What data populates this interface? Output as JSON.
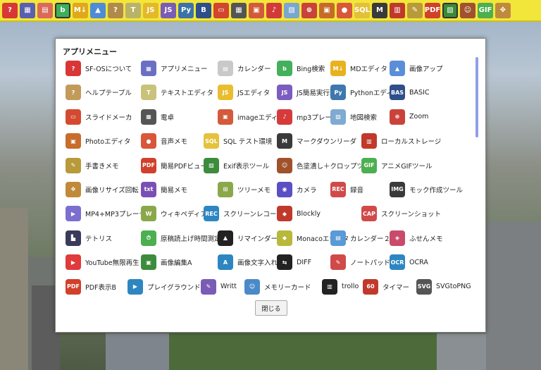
{
  "toolbar": {
    "icons": [
      {
        "name": "help-icon",
        "color": "#d93636",
        "glyph": "?"
      },
      {
        "name": "app-menu-icon",
        "color": "#5a5fb0",
        "glyph": "▦"
      },
      {
        "name": "calendar-icon",
        "color": "#d86a5a",
        "glyph": "▤"
      },
      {
        "name": "bing-icon",
        "color": "#3fae5a",
        "glyph": "b"
      },
      {
        "name": "md-editor-icon",
        "color": "#e0a91c",
        "glyph": "M↓"
      },
      {
        "name": "image-up-icon",
        "color": "#4f8bd6",
        "glyph": "▲"
      },
      {
        "name": "help-table-icon",
        "color": "#b08a4a",
        "glyph": "?"
      },
      {
        "name": "text-editor-icon",
        "color": "#b9b36a",
        "glyph": "T"
      },
      {
        "name": "js-editor-icon",
        "color": "#e5b82a",
        "glyph": "JS"
      },
      {
        "name": "js-runner-icon",
        "color": "#7a5bb5",
        "glyph": "JS"
      },
      {
        "name": "python-icon",
        "color": "#3b73a8",
        "glyph": "Py"
      },
      {
        "name": "basic-icon",
        "color": "#2f4f8a",
        "glyph": "B"
      },
      {
        "name": "slide-icon",
        "color": "#d2452f",
        "glyph": "▭"
      },
      {
        "name": "calculator-icon",
        "color": "#555555",
        "glyph": "▦"
      },
      {
        "name": "image-editor-icon",
        "color": "#d25a3a",
        "glyph": "▣"
      },
      {
        "name": "music-icon",
        "color": "#d23a3a",
        "glyph": "♪"
      },
      {
        "name": "map-icon",
        "color": "#7aa6cf",
        "glyph": "▧"
      },
      {
        "name": "zoom-icon",
        "color": "#c9433a",
        "glyph": "⊕"
      },
      {
        "name": "photo-editor-icon",
        "color": "#c66a2a",
        "glyph": "▣"
      },
      {
        "name": "voice-memo-icon",
        "color": "#d8563a",
        "glyph": "●"
      },
      {
        "name": "sql-icon",
        "color": "#e3c03a",
        "glyph": "SQL"
      },
      {
        "name": "markdown-reader-icon",
        "color": "#3a3a3a",
        "glyph": "M"
      },
      {
        "name": "local-storage-icon",
        "color": "#c0392b",
        "glyph": "▥"
      },
      {
        "name": "handwriting-icon",
        "color": "#b89a3a",
        "glyph": "✎"
      },
      {
        "name": "pdf-icon",
        "color": "#d0402a",
        "glyph": "PDF"
      },
      {
        "name": "exif-icon",
        "color": "#3a8a3a",
        "glyph": "▨"
      },
      {
        "name": "color-crop-icon",
        "color": "#a0522d",
        "glyph": "☺"
      },
      {
        "name": "gif-icon",
        "color": "#4caf50",
        "glyph": "GIF"
      },
      {
        "name": "resize-icon",
        "color": "#c08a3a",
        "glyph": "✥"
      }
    ]
  },
  "menu": {
    "title": "アプリメニュー",
    "close_label": "閉じる",
    "rows": [
      [
        {
          "label": "SF-OSについて",
          "icon": "help-icon",
          "color": "#d93636",
          "glyph": "?"
        },
        {
          "label": "アプリメニュー",
          "icon": "app-menu-icon",
          "color": "#6b6fc4",
          "glyph": "▦"
        },
        {
          "label": "カレンダー",
          "icon": "calendar-icon",
          "color": "#c9c9c9",
          "glyph": "▤"
        },
        {
          "label": "Bing検索",
          "icon": "bing-icon",
          "color": "#43b05c",
          "glyph": "b"
        },
        {
          "label": "MDエディタ",
          "icon": "md-editor-icon",
          "color": "#e8b11e",
          "glyph": "M↓"
        },
        {
          "label": "画像アップ",
          "icon": "image-up-icon",
          "color": "#5a8fd8",
          "glyph": "▲"
        }
      ],
      [
        {
          "label": "ヘルプテーブル",
          "icon": "help-table-icon",
          "color": "#c29a5a",
          "glyph": "?"
        },
        {
          "label": "テキストエディタ",
          "icon": "text-editor-icon",
          "color": "#c9c27a",
          "glyph": "T"
        },
        {
          "label": "JSエディタ",
          "icon": "js-editor-icon",
          "color": "#e9bd2e",
          "glyph": "JS"
        },
        {
          "label": "JS簡易実行環境",
          "icon": "js-runner-icon",
          "color": "#7c5cc0",
          "glyph": "JS"
        },
        {
          "label": "Pythonエディタ",
          "icon": "python-icon",
          "color": "#3e78ae",
          "glyph": "Py"
        },
        {
          "label": "BASIC",
          "icon": "basic-icon",
          "color": "#2f4f8a",
          "glyph": "BAS"
        }
      ],
      [
        {
          "label": "スライドメーカ",
          "icon": "slide-icon",
          "color": "#d44a30",
          "glyph": "▭"
        },
        {
          "label": "電卓",
          "icon": "calculator-icon",
          "color": "#555555",
          "glyph": "▦"
        },
        {
          "label": "imageエディタ",
          "icon": "image-editor-icon",
          "color": "#d35b3b",
          "glyph": "▣"
        },
        {
          "label": "mp3プレーヤ",
          "icon": "music-icon",
          "color": "#d63a3a",
          "glyph": "♪"
        },
        {
          "label": "地図検索",
          "icon": "map-icon",
          "color": "#7faad2",
          "glyph": "▧"
        },
        {
          "label": "Zoom",
          "icon": "zoom-icon",
          "color": "#c9433a",
          "glyph": "⊕"
        }
      ],
      [
        {
          "label": "Photoエディタ",
          "icon": "photo-editor-icon",
          "color": "#c86c2c",
          "glyph": "▣"
        },
        {
          "label": "音声メモ",
          "icon": "voice-memo-icon",
          "color": "#d8563a",
          "glyph": "●"
        },
        {
          "label": "SQL テスト環境",
          "icon": "sql-icon",
          "color": "#e5c23c",
          "glyph": "SQL"
        },
        {
          "label": "マークダウンリーダ",
          "icon": "markdown-reader-icon",
          "color": "#3a3a3a",
          "glyph": "M"
        },
        {
          "label": "ローカルストレージ",
          "icon": "local-storage-icon",
          "color": "#c0392b",
          "glyph": "▥"
        }
      ],
      [
        {
          "label": "手書きメモ",
          "icon": "handwriting-icon",
          "color": "#b89a3a",
          "glyph": "✎"
        },
        {
          "label": "簡易PDFビューワ",
          "icon": "pdf-icon",
          "color": "#d0402a",
          "glyph": "PDF"
        },
        {
          "label": "Exif表示ツール",
          "icon": "exif-icon",
          "color": "#3d8c3d",
          "glyph": "▨"
        },
        {
          "label": "色塗潰し＋クロップツール",
          "icon": "color-crop-icon",
          "color": "#a0522d",
          "glyph": "☺"
        },
        {
          "label": "アニメGIFツール",
          "icon": "gif-icon",
          "color": "#4caf50",
          "glyph": "GIF"
        }
      ],
      [
        {
          "label": "画像リサイズ回転",
          "icon": "resize-icon",
          "color": "#c08a3a",
          "glyph": "✥"
        },
        {
          "label": "簡易メモ",
          "icon": "memo-icon",
          "color": "#7a4fb5",
          "glyph": "txt"
        },
        {
          "label": "ツリーメモ",
          "icon": "tree-memo-icon",
          "color": "#8aa84a",
          "glyph": "⊞"
        },
        {
          "label": "カメラ",
          "icon": "camera-icon",
          "color": "#5b4fc4",
          "glyph": "◉"
        },
        {
          "label": "録音",
          "icon": "record-icon",
          "color": "#d04a4a",
          "glyph": "REC"
        },
        {
          "label": "モック作成ツール",
          "icon": "mock-icon",
          "color": "#3a3a3a",
          "glyph": "IMG"
        }
      ],
      [
        {
          "label": "MP4+MP3プレーヤー",
          "icon": "mp4-icon",
          "color": "#7a6fd0",
          "glyph": "▶"
        },
        {
          "label": "ウィキペディア",
          "icon": "wikipedia-icon",
          "color": "#8aa84a",
          "glyph": "W"
        },
        {
          "label": "スクリーンレコーダー",
          "icon": "screen-recorder-icon",
          "color": "#2e86c1",
          "glyph": "REC"
        },
        {
          "label": "Blockly",
          "icon": "blockly-icon",
          "color": "#c0392b",
          "glyph": "◆"
        },
        {
          "label": "スクリーンショット",
          "icon": "screenshot-icon",
          "color": "#d04a4a",
          "glyph": "CAP"
        }
      ],
      [
        {
          "label": "テトリス",
          "icon": "tetris-icon",
          "color": "#3a3a5a",
          "glyph": "▙"
        },
        {
          "label": "原稿読上げ時間測定",
          "icon": "reading-time-icon",
          "color": "#4caf50",
          "glyph": "⏱"
        },
        {
          "label": "リマインダー",
          "icon": "bell-icon",
          "color": "#222222",
          "glyph": "▲"
        },
        {
          "label": "Monacoエディタ",
          "icon": "monaco-icon",
          "color": "#b8b83a",
          "glyph": "◆"
        },
        {
          "label": "カレンダー２",
          "icon": "calendar2-icon",
          "color": "#5a9ad6",
          "glyph": "▤"
        },
        {
          "label": "ふせんメモ",
          "icon": "sticky-note-icon",
          "color": "#c94a6a",
          "glyph": "◈"
        }
      ],
      [
        {
          "label": "YouTube無限再生",
          "icon": "youtube-icon",
          "color": "#e03a3a",
          "glyph": "▶"
        },
        {
          "label": "画像編集A",
          "icon": "image-edit-a-icon",
          "color": "#3d8c3d",
          "glyph": "▣"
        },
        {
          "label": "画像文字入れ",
          "icon": "image-text-icon",
          "color": "#2e86c1",
          "glyph": "A"
        },
        {
          "label": "DIFF",
          "icon": "diff-icon",
          "color": "#222222",
          "glyph": "⇆"
        },
        {
          "label": "ノートパッド",
          "icon": "notepad-icon",
          "color": "#d04a4a",
          "glyph": "✎"
        },
        {
          "label": "OCRA",
          "icon": "ocr-icon",
          "color": "#2e86c1",
          "glyph": "OCR"
        }
      ],
      [
        {
          "label": "PDF表示B",
          "icon": "pdf-viewer-icon",
          "color": "#d0402a",
          "glyph": "PDF"
        },
        {
          "label": "プレイグラウンド",
          "icon": "playground-icon",
          "color": "#2e86c1",
          "glyph": "▶"
        },
        {
          "label": "Writt",
          "icon": "writt-icon",
          "color": "#7a5bb5",
          "glyph": "✎"
        },
        {
          "label": "メモリーカード",
          "icon": "memory-card-icon",
          "color": "#4a8ac8",
          "glyph": "☺"
        },
        {
          "label": "trollo",
          "icon": "trollo-icon",
          "color": "#222222",
          "glyph": "▥"
        },
        {
          "label": "タイマー",
          "icon": "timer-icon",
          "color": "#c0392b",
          "glyph": "60"
        },
        {
          "label": "SVGtoPNG",
          "icon": "svg-png-icon",
          "color": "#555555",
          "glyph": "SVG"
        }
      ]
    ]
  }
}
